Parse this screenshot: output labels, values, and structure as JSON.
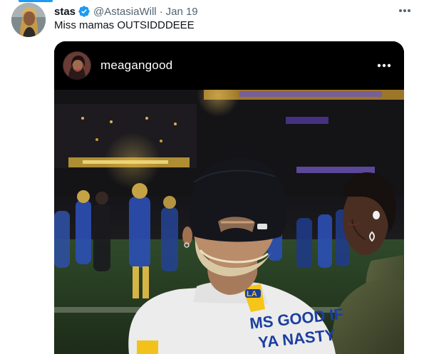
{
  "tweet": {
    "display_name": "stas",
    "handle": "@AstasiaWill",
    "separator": "·",
    "time": "Jan 19",
    "text": "Miss mamas OUTSIDDDEEE",
    "verified_icon": "verified-badge-icon",
    "more_icon": "more-horizontal-icon"
  },
  "embed": {
    "username": "meagangood",
    "more_icon": "more-horizontal-icon",
    "jersey_patch": "LA",
    "jersey_text_line1": "MS GOOD IF",
    "jersey_text_line2": "YA NASTY"
  },
  "colors": {
    "accent": "#1d9bf0",
    "secondary_text": "#536471",
    "rams_blue": "#1b3fa0",
    "rams_gold": "#f5c518"
  }
}
